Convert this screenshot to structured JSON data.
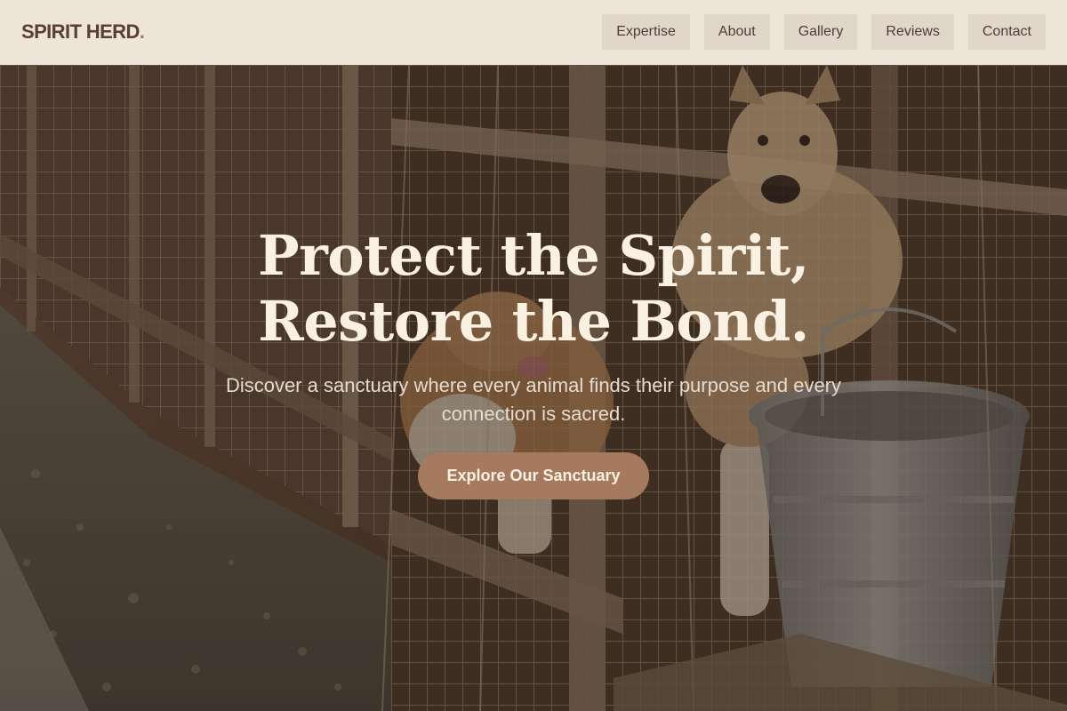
{
  "header": {
    "logo_text": "SPIRIT HERD",
    "logo_dot": ".",
    "nav": [
      {
        "label": "Expertise"
      },
      {
        "label": "About"
      },
      {
        "label": "Gallery"
      },
      {
        "label": "Reviews"
      },
      {
        "label": "Contact"
      }
    ]
  },
  "hero": {
    "title_line1": "Protect the Spirit,",
    "title_line2": "Restore the Bond.",
    "subtitle": "Discover a sanctuary where every animal finds their purpose and every connection is sacred.",
    "cta_label": "Explore Our Sanctuary"
  },
  "colors": {
    "header_bg": "#ede5d8",
    "nav_button_bg": "#e0d6ca",
    "logo": "#5a3f33",
    "accent": "#a57a5e",
    "hero_text": "#fbf1e3"
  }
}
